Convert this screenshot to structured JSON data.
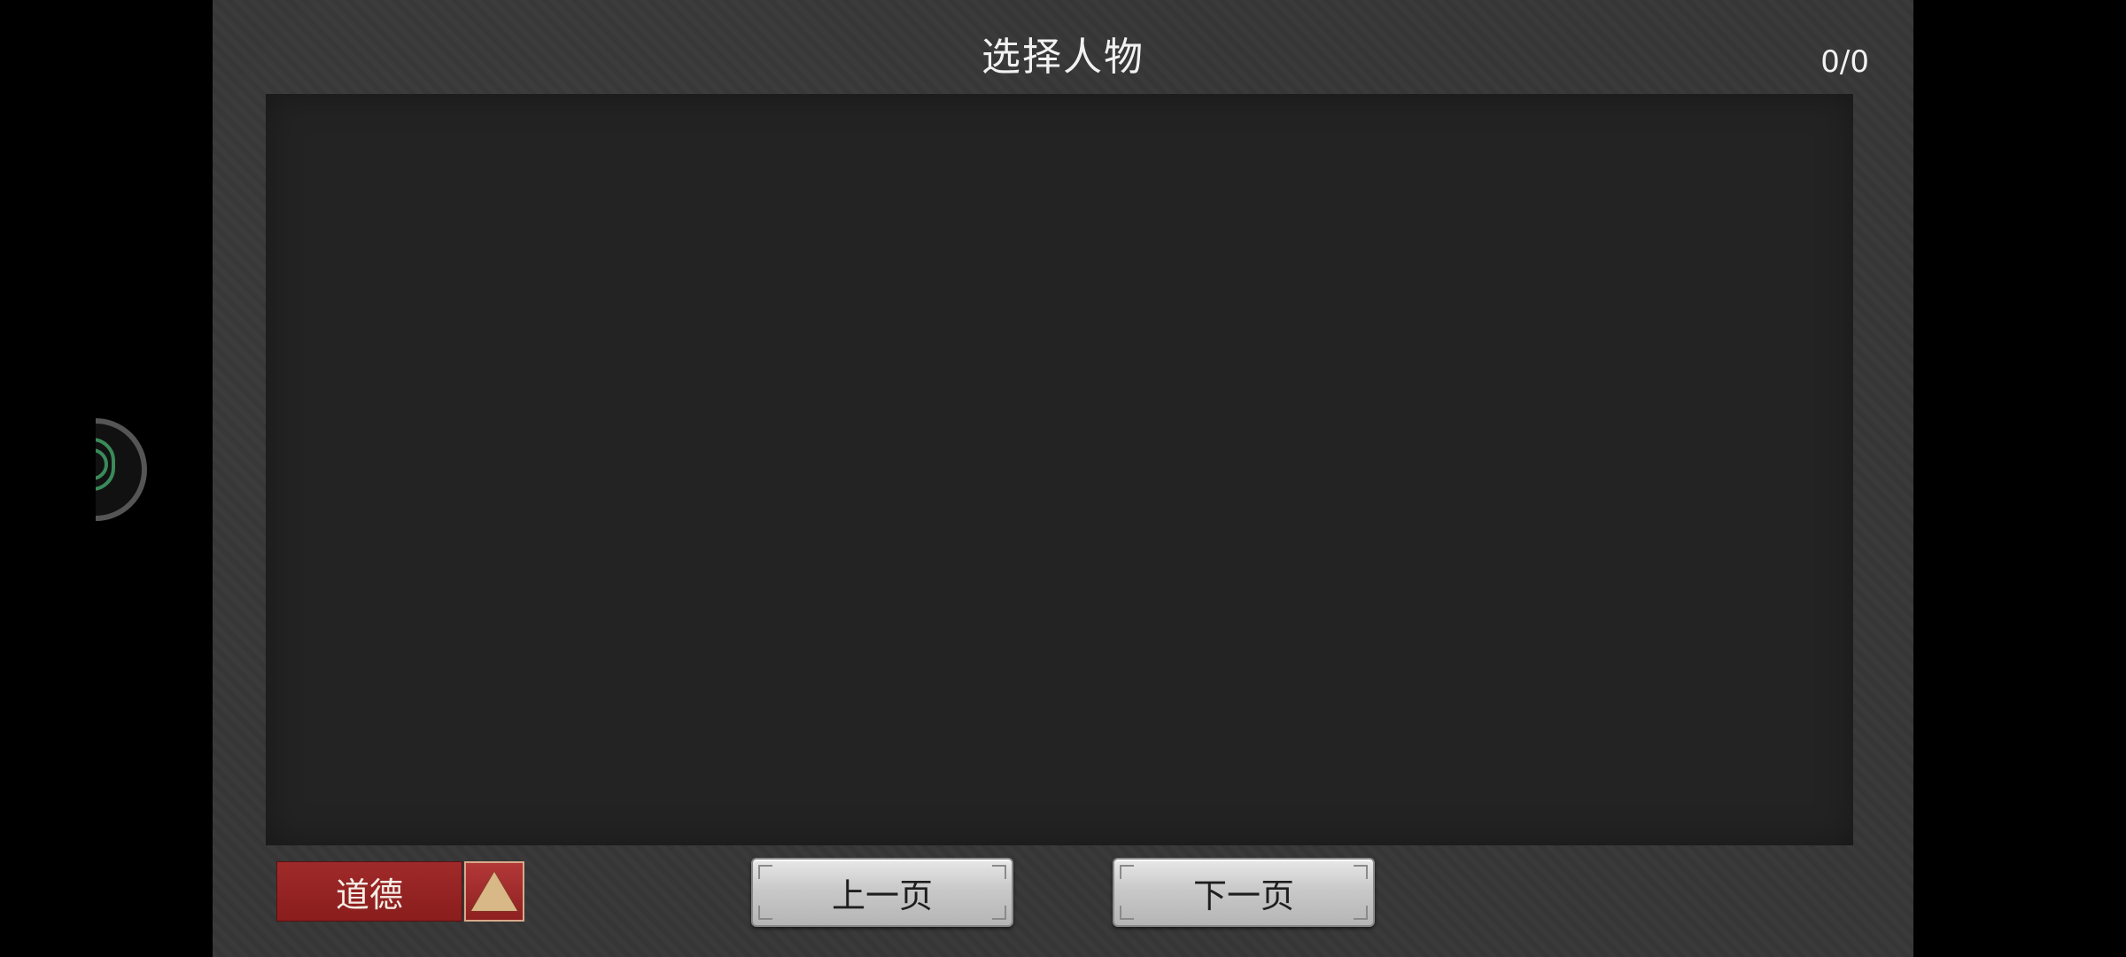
{
  "header": {
    "title": "选择人物",
    "page_indicator": "0/0"
  },
  "list": {
    "items": []
  },
  "footer": {
    "sort_label": "道德",
    "sort_direction": "ascending",
    "prev_label": "上一页",
    "next_label": "下一页"
  },
  "icons": {
    "sort_toggle": "triangle-up-icon",
    "floating_handle": "assistive-ball-icon"
  },
  "colors": {
    "sort_red": "#9a2424",
    "button_silver": "#c9c9c9",
    "panel_bg": "#383838",
    "list_bg": "#232323"
  }
}
